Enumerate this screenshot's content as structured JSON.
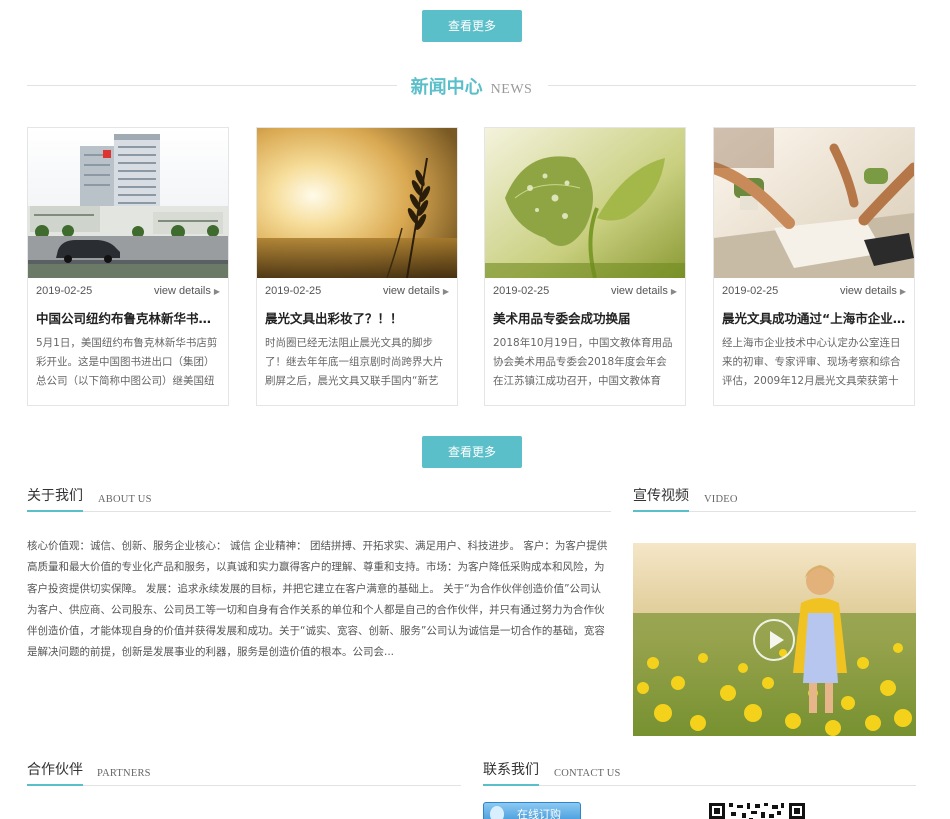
{
  "buttons": {
    "view_more_top": "查看更多",
    "view_more_bottom": "查看更多"
  },
  "news": {
    "title_cn": "新闻中心",
    "title_en": "NEWS",
    "more_label": "view details",
    "items": [
      {
        "date": "2019-02-25",
        "title": "中国公司纽约布鲁克林新华书店...",
        "desc": "5月1日，美国纽约布鲁克林新华书店剪彩开业。这是中国图书进出口（集团）总公司（以下简称中图公司）继美国纽",
        "image": "hospital-building"
      },
      {
        "date": "2019-02-25",
        "title": "晨光文具出彩妆了？！！",
        "desc": "时尚圈已经无法阻止晨光文具的脚步了！继去年年底一组京剧时尚跨界大片刷屏之后，晨光文具又联手国内“新艺",
        "image": "wheat-sunset"
      },
      {
        "date": "2019-02-25",
        "title": "美术用品专委会成功换届",
        "desc": "2018年10月19日，中国文教体育用品协会美术用品专委会2018年度会年会在江苏镇江成功召开，中国文教体育用...",
        "image": "leaf-sprout"
      },
      {
        "date": "2019-02-25",
        "title": "晨光文具成功通过“上海市企业...",
        "desc": "经上海市企业技术中心认定办公室连日来的初审、专家评审、现场考察和综合评估，2009年12月晨光文具荣获第十五",
        "image": "office-desk"
      }
    ]
  },
  "about": {
    "title_cn": "关于我们",
    "title_en": "ABOUT US",
    "text": "核心价值观：诚信、创新、服务企业核心： 诚信 企业精神： 团结拼搏、开拓求实、满足用户、科技进步。 客户：为客户提供高质量和最大价值的专业化产品和服务，以真诚和实力赢得客户的理解、尊重和支持。市场：为客户降低采购成本和风险，为客户投资提供切实保障。 发展：追求永续发展的目标，并把它建立在客户满意的基础上。 关于“为合作伙伴创造价值”公司认为客户、供应商、公司股东、公司员工等一切和自身有合作关系的单位和个人都是自己的合作伙伴，并只有通过努力为合作伙伴创造价值，才能体现自身的价值并获得发展和成功。关于“诚实、宽容、创新、服务”公司认为诚信是一切合作的基础，宽容是解决问题的前提，创新是发展事业的利器，服务是创造价值的根本。公司会..."
  },
  "video": {
    "title_cn": "宣传视频",
    "title_en": "VIDEO",
    "image": "girl-in-daffodil-field",
    "play_icon": "play-icon"
  },
  "partners": {
    "title_cn": "合作伙伴",
    "title_en": "PARTNERS"
  },
  "contact": {
    "title_cn": "联系我们",
    "title_en": "CONTACT US",
    "online_label": "在线订购"
  },
  "colors": {
    "accent": "#5bbfca",
    "divider": "#e2e2e2"
  }
}
